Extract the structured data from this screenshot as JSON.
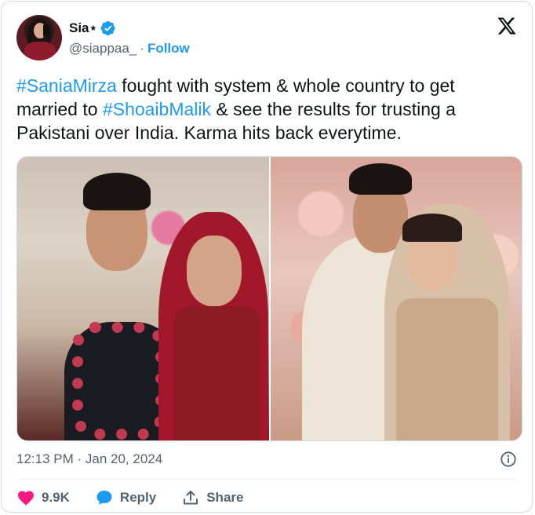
{
  "author": {
    "display_name": "Sia⋆",
    "handle": "@siappaa_",
    "separator": "·",
    "follow_label": "Follow"
  },
  "tweet": {
    "text_parts": [
      {
        "type": "hashtag",
        "text": "#SaniaMirza"
      },
      {
        "type": "text",
        "text": " fought with system & whole country to get married to "
      },
      {
        "type": "hashtag",
        "text": "#ShoaibMalik"
      },
      {
        "type": "text",
        "text": " & see the results for trusting a Pakistani over India. Karma hits back everytime."
      }
    ]
  },
  "media": {
    "images": [
      "wedding-photo-left",
      "wedding-photo-right"
    ]
  },
  "meta": {
    "timestamp": "12:13 PM · Jan 20, 2024"
  },
  "actions": {
    "likes": "9.9K",
    "reply_label": "Reply",
    "share_label": "Share"
  },
  "colors": {
    "accent": "#1d9bf0",
    "like": "#f91880",
    "text": "#0f1419",
    "muted": "#536471"
  },
  "icons": [
    "verified-badge-icon",
    "x-logo-icon",
    "info-icon",
    "heart-icon",
    "reply-icon",
    "share-icon"
  ]
}
